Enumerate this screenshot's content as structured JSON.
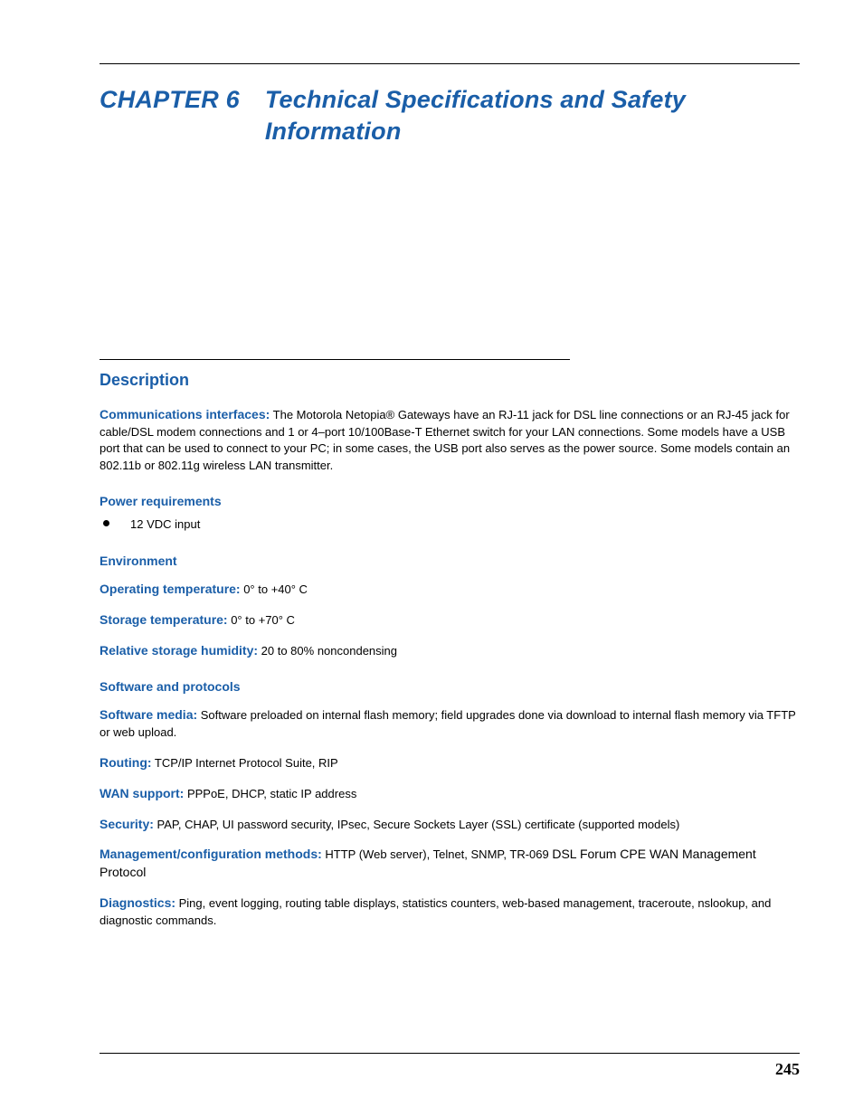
{
  "chapter": {
    "label": "CHAPTER 6",
    "title": "Technical Specifications and Safety Information"
  },
  "section": {
    "heading": "Description",
    "comm": {
      "label": "Communications interfaces:",
      "text": " The Motorola Netopia® Gateways have an RJ-11 jack for DSL line connections or an RJ-45 jack for cable/DSL modem connections and 1 or 4–port 10/100Base-T Ethernet switch for your LAN connections. Some models have a USB port that can be used to connect to your PC; in some cases, the USB port also serves as the power source. Some models contain an 802.11b or 802.11g wireless LAN transmitter."
    },
    "power": {
      "heading": "Power requirements",
      "item": "12 VDC input"
    },
    "env": {
      "heading": "Environment",
      "op_label": "Operating temperature:",
      "op_val": " 0° to +40° C",
      "st_label": "Storage temperature:",
      "st_val": " 0° to +70° C",
      "hum_label": "Relative storage humidity:",
      "hum_val": " 20 to 80% noncondensing"
    },
    "soft": {
      "heading": "Software and protocols",
      "media_label": "Software media:",
      "media_val": " Software preloaded on internal flash memory; field upgrades done via download to internal flash memory via TFTP or web upload.",
      "routing_label": "Routing:",
      "routing_val": " TCP/IP Internet Protocol Suite, RIP",
      "wan_label": "WAN support:",
      "wan_val": " PPPoE, DHCP, static IP address",
      "sec_label": "Security:",
      "sec_val": " PAP, CHAP, UI password security, IPsec, Secure Sockets Layer (SSL) certificate (supported models)",
      "mgmt_label": "Management/configuration methods:",
      "mgmt_val_a": "  HTTP (Web server), Telnet, SNMP, TR-069 ",
      "mgmt_val_b": "DSL Forum CPE WAN Management Protocol",
      "diag_label": "Diagnostics:",
      "diag_val": " Ping, event logging, routing table displays, statistics counters, web-based management, traceroute, nslookup, and diagnostic commands."
    }
  },
  "page_number": "245"
}
